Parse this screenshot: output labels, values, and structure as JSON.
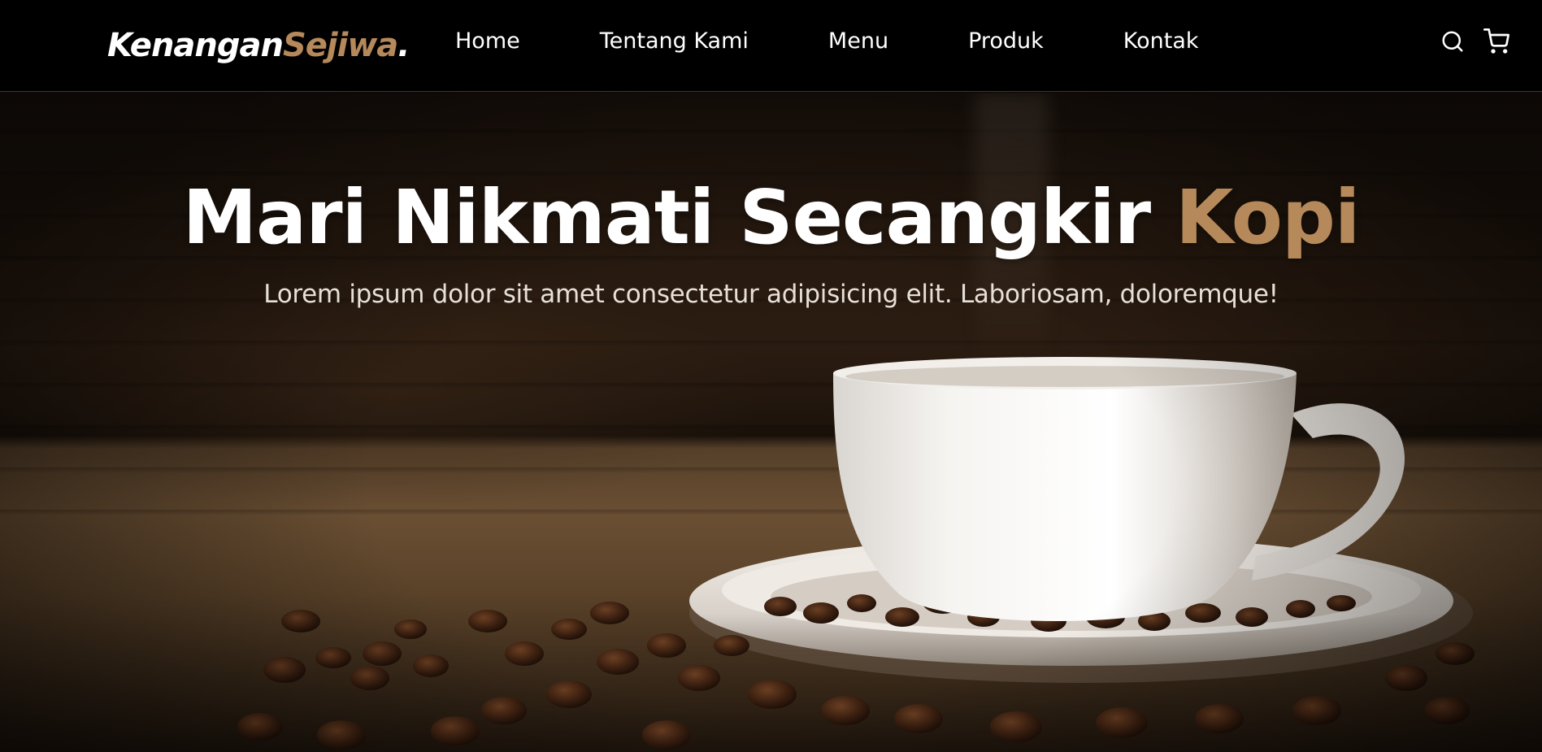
{
  "brand": {
    "name_main": "Kenangan",
    "name_accent": "Sejiwa",
    "name_dot": ".",
    "accent_color": "#b6895b"
  },
  "nav": {
    "items": [
      {
        "label": "Home"
      },
      {
        "label": "Tentang Kami"
      },
      {
        "label": "Menu"
      },
      {
        "label": "Produk"
      },
      {
        "label": "Kontak"
      }
    ],
    "icons": [
      "search-icon",
      "shopping-cart-icon"
    ]
  },
  "hero": {
    "title_main": "Mari Nikmati Secangkir ",
    "title_accent": "Kopi",
    "subtitle": "Lorem ipsum dolor sit amet consectetur adipisicing elit. Laboriosam, doloremque!",
    "background_image": "coffee-cup-with-beans"
  },
  "colors": {
    "navbar_bg": "#000000",
    "text": "#ffffff",
    "accent": "#b6895b"
  }
}
